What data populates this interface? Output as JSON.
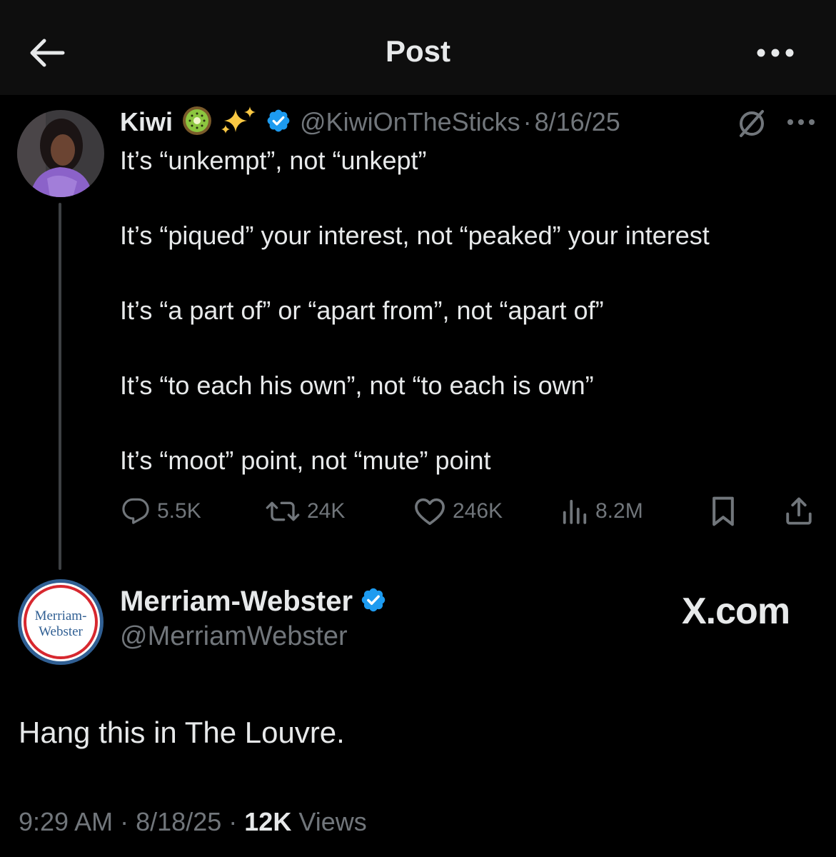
{
  "header": {
    "title": "Post"
  },
  "parent_tweet": {
    "display_name": "Kiwi",
    "name_emojis": "🥝✨",
    "handle": "@KiwiOnTheSticks",
    "separator": "·",
    "date": "8/16/25",
    "lines": [
      "It’s “unkempt”, not “unkept”",
      "It’s “piqued” your interest, not “peaked” your interest",
      "It’s “a part of” or “apart from”, not “apart of”",
      "It’s “to each his own”, not “to each is own”",
      "It’s “moot” point, not “mute” point"
    ],
    "stats": {
      "replies": "5.5K",
      "reposts": "24K",
      "likes": "246K",
      "views": "8.2M"
    }
  },
  "reply": {
    "display_name": "Merriam-Webster",
    "handle": "@MerriamWebster",
    "avatar_text_1": "Merriam-",
    "avatar_text_2": "Webster",
    "text": "Hang this in The Louvre.",
    "time": "9:29 AM",
    "separator": "·",
    "date": "8/18/25",
    "views_count": "12K",
    "views_label": "Views"
  },
  "watermark": "X.com",
  "colors": {
    "background": "#000000",
    "header_bg": "#0e0e0e",
    "text_primary": "#e7e9ea",
    "text_secondary": "#71767b",
    "verified_blue": "#1d9bf0",
    "mw_red": "#d7282f",
    "mw_blue": "#305f93"
  },
  "icons": [
    "back-arrow-icon",
    "more-horizontal-icon",
    "verified-badge-icon",
    "grok-icon",
    "reply-icon",
    "repost-icon",
    "like-icon",
    "views-icon",
    "bookmark-icon",
    "share-icon"
  ]
}
